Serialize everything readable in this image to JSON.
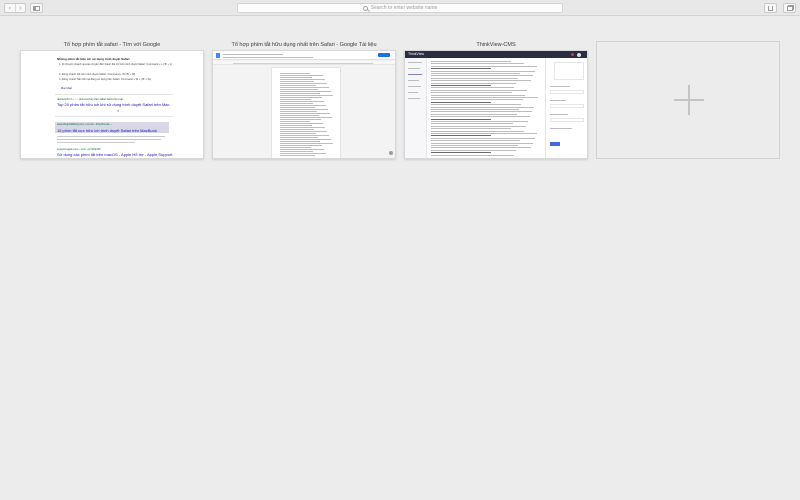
{
  "toolbar": {
    "back_icon": "chevron-left-icon",
    "forward_icon": "chevron-right-icon",
    "sidebar_icon": "sidebar-icon",
    "address_placeholder": "Search or enter website name",
    "share_icon": "share-icon",
    "tabs_icon": "tab-overview-icon"
  },
  "tabs": [
    {
      "title": "Tổ hợp phím tắt safari - Tìm với Google",
      "thumb": {
        "heading": "Những phím tắt hữu ích sử dụng trình duyệt Safari",
        "items": [
          "1. Di chuyển nhanh qua lại chuyển đến thanh địa chỉ trên trình duyệt Safari: Command + L (⌘ + L)",
          "2. Đóng nhanh tab trên trình duyệt Safari: Command + W (⌘ + W)",
          "3. Đóng nhanh Tab hiện tại đang sử dụng trên Safari: Command + W + (⌘ + W)"
        ],
        "more": "Mục khác",
        "source1": "taimienphi.vn › ... › phim-tat-hay-tren-safari-danh-cho-mac",
        "link1": "Top 20 phím tắt hữu ích khi sử dụng trình duyệt Safari trên Mac",
        "source2": "www.thegioididong.com › tin-tuc › 15-phim-tat-...",
        "link2": "15 phím tắt cực hữu ích trình duyệt Safari trên MacBook",
        "source3": "support.apple.com › vi-vn › HT201236",
        "link3": "Sử dụng các phím tắt trên macOS - Apple Hỗ trợ - Apple Support"
      }
    },
    {
      "title": "Tổ hợp phím tắt hữu dụng nhất trên Safari - Google Tài liệu"
    },
    {
      "title": "ThinkView-CMS",
      "thumb": {
        "brand": "ThinkView"
      }
    }
  ],
  "new_tab": {
    "icon": "plus-icon"
  }
}
